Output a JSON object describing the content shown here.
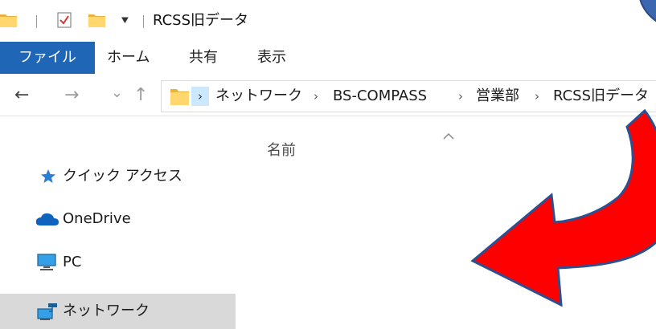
{
  "window": {
    "title": "RCSS旧データ",
    "quick_access_dropdown": "⯆"
  },
  "ribbon": {
    "tabs": [
      "ファイル",
      "ホーム",
      "共有",
      "表示"
    ],
    "active_tab": "ファイル"
  },
  "navigation": {
    "back": "←",
    "forward": "→",
    "recent": "⌄",
    "up": "↑"
  },
  "address": {
    "separator": "›",
    "crumbs": [
      "ネットワーク",
      "BS-COMPASS",
      "営業部",
      "RCSS旧データ"
    ]
  },
  "nav_pane": {
    "items": [
      {
        "label": "クイック アクセス",
        "icon": "star-icon"
      },
      {
        "label": "OneDrive",
        "icon": "cloud-icon"
      },
      {
        "label": "PC",
        "icon": "monitor-icon"
      },
      {
        "label": "ネットワーク",
        "icon": "network-icon",
        "selected": true
      }
    ]
  },
  "content": {
    "column_header": "名前",
    "sort": "ascending"
  },
  "annotation": {
    "arrow_color": "#ff0000",
    "callout_color": "#3b66b0"
  },
  "colors": {
    "accent": "#1f66b7",
    "folder": "#ffd76e",
    "selection": "#cce8ff",
    "nav_selected": "#d9d9d9"
  }
}
